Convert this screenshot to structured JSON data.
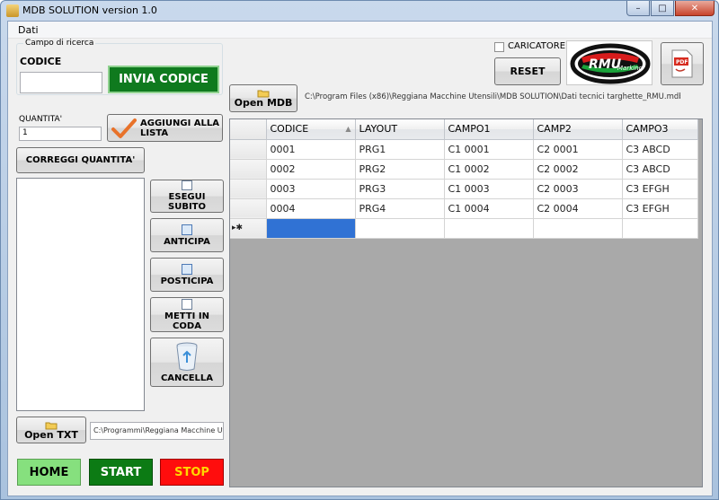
{
  "window": {
    "title": "MDB SOLUTION version 1.0",
    "controls": {
      "minimize": "–",
      "maximize": "□",
      "close": "✕"
    }
  },
  "menu": {
    "items": [
      "Dati"
    ]
  },
  "search": {
    "group_label": "Campo di ricerca",
    "code_label": "CODICE",
    "code_value": "",
    "send_button": "INVIA CODICE"
  },
  "quantity": {
    "label": "QUANTITA'",
    "value": "1",
    "add_button": "AGGIUNGI ALLA LISTA",
    "fix_button": "CORREGGI QUANTITA'"
  },
  "queue_actions": {
    "run_now": "ESEGUI SUBITO",
    "move_up": "ANTICIPA",
    "move_down": "POSTICIPA",
    "enqueue": "METTI IN CODA",
    "delete": "CANCELLA"
  },
  "txt": {
    "open_button": "Open TXT",
    "path": "C:\\Programmi\\Reggiana Macchine Ute"
  },
  "bottom": {
    "home": "HOME",
    "start": "START",
    "stop": "STOP"
  },
  "loader": {
    "label": "CARICATORE",
    "checked": false,
    "reset_button": "RESET"
  },
  "logo": {
    "text": "RMU",
    "sub": "Marking"
  },
  "pdf": {
    "icon": "pdf-icon"
  },
  "mdb": {
    "open_button": "Open MDB",
    "path": "C:\\Program Files (x86)\\Reggiana Macchine Utensili\\MDB SOLUTION\\Dati tecnici targhette_RMU.mdb"
  },
  "grid": {
    "columns": [
      "CODICE",
      "LAYOUT",
      "CAMPO1",
      "CAMP2",
      "CAMPO3"
    ],
    "rows": [
      [
        "0001",
        "PRG1",
        "C1 0001",
        "C2 0001",
        "C3 ABCD"
      ],
      [
        "0002",
        "PRG2",
        "C1 0002",
        "C2 0002",
        "C3 ABCD"
      ],
      [
        "0003",
        "PRG3",
        "C1 0003",
        "C2 0003",
        "C3 EFGH"
      ],
      [
        "0004",
        "PRG4",
        "C1 0004",
        "C2 0004",
        "C3 EFGH"
      ]
    ],
    "new_row_marker": "▸✱"
  }
}
